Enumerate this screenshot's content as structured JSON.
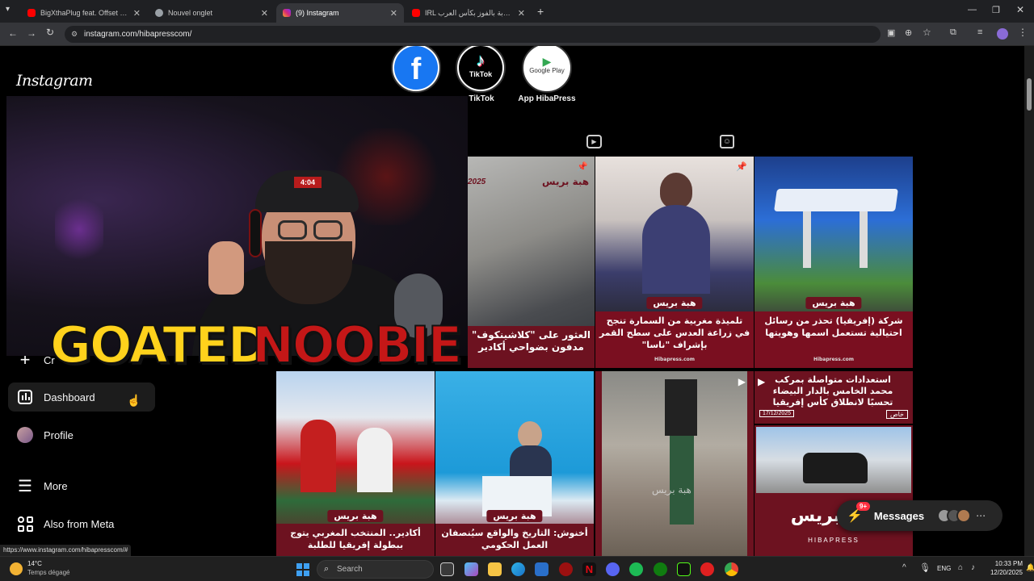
{
  "browser": {
    "tabs": [
      {
        "title": "BigXthaPlug feat. Offset - Climax",
        "favicon_color": "#ff0000"
      },
      {
        "title": "Nouvel onglet",
        "favicon_color": "#9aa0a6"
      },
      {
        "title": "(9) Instagram",
        "favicon_color": "#d62976"
      },
      {
        "title": "IRL المغاربة بالفوز بكأس العرب",
        "favicon_color": "#ff0000"
      }
    ],
    "url": "instagram.com/hibapresscom/",
    "status_url": "https://www.instagram.com/hibapresscom/#"
  },
  "instagram": {
    "logo": "Instagram",
    "nav": [
      {
        "label": "Cr",
        "icon": "plus-icon"
      },
      {
        "label": "Dashboard",
        "icon": "dashboard-icon"
      },
      {
        "label": "Profile",
        "icon": "avatar-icon"
      },
      {
        "label": "More",
        "icon": "menu-icon"
      },
      {
        "label": "Also from Meta",
        "icon": "meta-apps-icon"
      }
    ],
    "highlights": [
      {
        "label": "",
        "icon": "facebook-icon"
      },
      {
        "label": "TikTok",
        "icon": "tiktok-icon",
        "inner_text": "TikTok"
      },
      {
        "label": "App HibaPress",
        "icon": "google-play-icon",
        "inner_text": "Google Play"
      }
    ],
    "posts": [
      {
        "caption": "العثور على \"كلاشينكوف\" مدفون بضواحي أكادير",
        "brand": "هبة بريس",
        "date": "2025"
      },
      {
        "caption": "تلميذة مغربية من السمارة تنجح في زراعة العدس على سطح القمر بإشراف \"ناسا\"",
        "brand": "هبة بريس",
        "source": "Hibapress.com"
      },
      {
        "caption": "شركة (إفريقيا) تحذر من رسائل احتيالية تستعمل اسمها وهويتها",
        "brand": "هبة بريس",
        "source": "Hibapress.com"
      },
      {
        "caption": "أكادير.. المنتخب المغربي يتوج ببطولة إفريقيا للطلبة",
        "brand": "هبة بريس"
      },
      {
        "caption": "أخنوش: التاريخ والواقع سيُنصفان العمل الحكومي",
        "brand": "هبة بريس"
      },
      {
        "caption": "",
        "brand": "هبة بريس"
      },
      {
        "caption": "استعدادات متواصلة بمركب محمد الخامس بالدار البيضاء تحسبًا لانطلاق كأس إفريقيا",
        "date": "17/12/2025",
        "tag": "خاص"
      },
      {
        "caption": "",
        "brand": "هبة بريس",
        "sub": "HIBAPRESS"
      }
    ]
  },
  "overlay": {
    "word1": "GOATED",
    "word2": "NOOBIE",
    "cap": "4:04"
  },
  "messages": {
    "label": "Messages",
    "badge": "9+"
  },
  "taskbar": {
    "weather_temp": "14°C",
    "weather_desc": "Temps dégagé",
    "search_placeholder": "Search",
    "lang": "ENG",
    "time": "10:33 PM",
    "date": "12/20/2025"
  }
}
